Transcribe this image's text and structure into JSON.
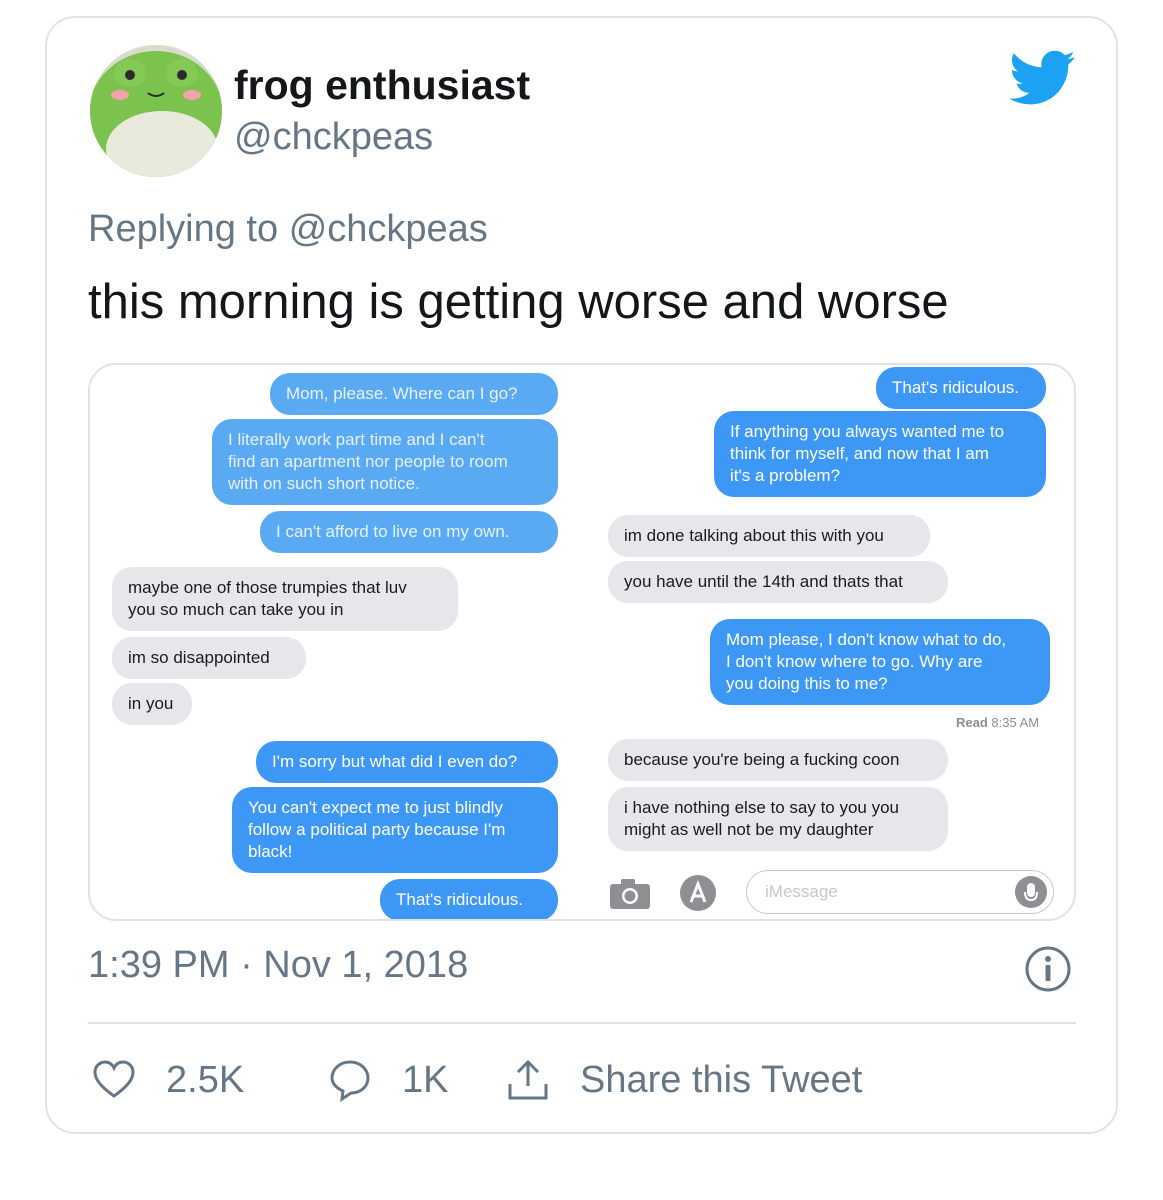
{
  "tweet": {
    "display_name": "frog enthusiast",
    "handle": "@chckpeas",
    "replying_prefix": "Replying to",
    "replying_handle": "@chckpeas",
    "text": "this morning is getting worse and worse",
    "timestamp": "1:39 PM · Nov 1, 2018",
    "likes": "2.5K",
    "replies": "1K",
    "share_label": "Share this Tweet",
    "brand_color": "#1da1f2",
    "icons": [
      "twitter-bird-icon",
      "info-icon",
      "heart-icon",
      "reply-icon",
      "share-icon"
    ]
  },
  "screenshot": {
    "left_column": [
      {
        "from": "me",
        "text": "Mom, please. Where can I go?"
      },
      {
        "from": "me",
        "text": "I literally work part time and I can't\nfind an apartment nor people to room\nwith on such short notice."
      },
      {
        "from": "me",
        "text": "I can't afford to live on my own."
      },
      {
        "from": "them",
        "text": "maybe one of those trumpies that luv\nyou so much can take you in"
      },
      {
        "from": "them",
        "text": "im so disappointed"
      },
      {
        "from": "them",
        "text": "in you"
      },
      {
        "from": "me",
        "text": "I'm sorry but what did I even do?"
      },
      {
        "from": "me",
        "text": "You can't expect me to just blindly\nfollow a political party because I'm\nblack!"
      },
      {
        "from": "me",
        "text": "That's ridiculous."
      }
    ],
    "right_column": [
      {
        "from": "me",
        "text": "That's ridiculous."
      },
      {
        "from": "me",
        "text": "If anything you always wanted me to\nthink for myself, and now that I am\nit's a problem?"
      },
      {
        "from": "them",
        "text": "im done talking about this with you"
      },
      {
        "from": "them",
        "text": "you have until the 14th and thats that"
      },
      {
        "from": "me",
        "text": "Mom please, I don't know what to do,\nI don't know where to go. Why are\nyou doing this to me?"
      },
      {
        "from": "them",
        "text": "because you're being a fucking coon"
      },
      {
        "from": "them",
        "text": "i have nothing else to say to you you\nmight as well not be my daughter"
      }
    ],
    "read_label": "Read",
    "read_time": "8:35 AM",
    "input_placeholder": "iMessage",
    "colors": {
      "sent": "#3d98f5",
      "received": "#e6e6eb"
    }
  }
}
